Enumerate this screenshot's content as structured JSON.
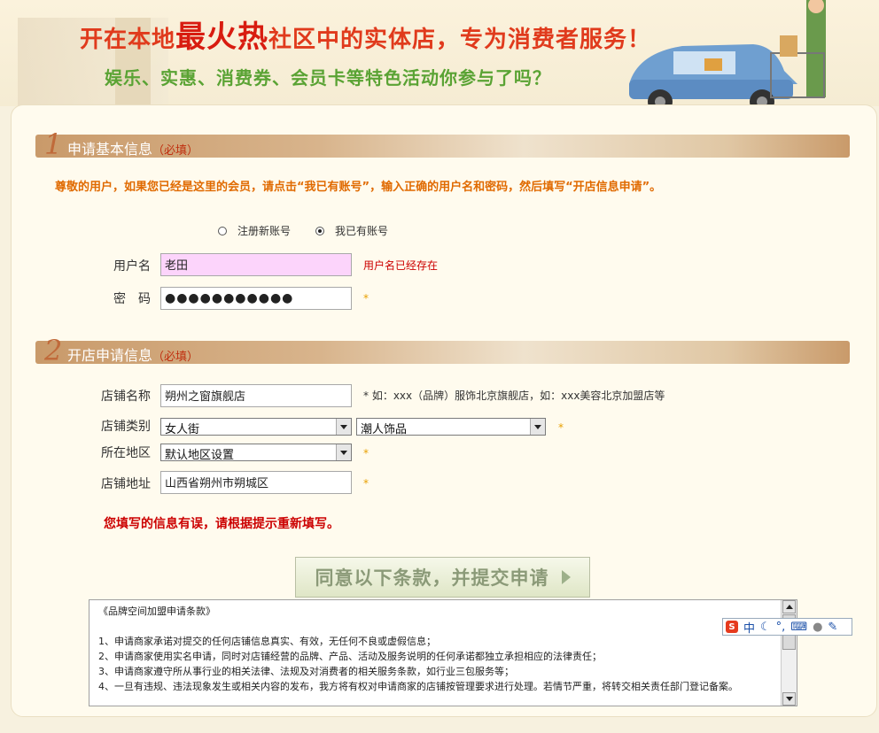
{
  "banner": {
    "headline_a": "开在本地",
    "headline_b": "最火热",
    "headline_c": "社区中的实体店，专为消费者服务！",
    "subline": "娱乐、实惠、消费券、会员卡等特色活动你参与了吗？"
  },
  "section1": {
    "num": "1",
    "title": "申请基本信息",
    "required": "（必填）"
  },
  "notice": "尊敬的用户，如果您已经是这里的会员，请点击“我已有账号”，输入正确的用户名和密码，然后填写“开店信息申请”。",
  "account": {
    "option_new": "注册新账号",
    "option_existing": "我已有账号",
    "selected": "option_existing"
  },
  "login": {
    "username_label": "用户名",
    "username_value": "老田",
    "username_error": "用户名已经存在",
    "password_label": "密　码",
    "password_mask": "●●●●●●●●●●●",
    "star": "*"
  },
  "section2": {
    "num": "2",
    "title": "开店申请信息",
    "required": "（必填）"
  },
  "shop": {
    "name_label": "店铺名称",
    "name_value": "朔州之窗旗舰店",
    "name_hint": "* 如：xxx（品牌）服饰北京旗舰店，如：xxx美容北京加盟店等",
    "type_label": "店铺类别",
    "type_value1": "女人街",
    "type_value2": "潮人饰品",
    "region_label": "所在地区",
    "region_value": "默认地区设置",
    "address_label": "店铺地址",
    "address_value": "山西省朔州市朔城区",
    "star": "*"
  },
  "form_error": "您填写的信息有误，请根据提示重新填写。",
  "submit_label": "同意以下条款，并提交申请",
  "terms": {
    "title": "《品牌空间加盟申请条款》",
    "items": [
      "1、申请商家承诺对提交的任何店铺信息真实、有效，无任何不良或虚假信息；",
      "2、申请商家使用实名申请，同时对店铺经营的品牌、产品、活动及服务说明的任何承诺都独立承担相应的法律责任；",
      "3、申请商家遵守所从事行业的相关法律、法规及对消费者的相关服务条款，如行业三包服务等；",
      "4、一旦有违规、违法现象发生或相关内容的发布，我方将有权对申请商家的店铺按管理要求进行处理。若情节严重，将转交相关责任部门登记备案。"
    ]
  },
  "ime": {
    "logo": "S",
    "mode": "中"
  },
  "colors": {
    "accent": "#e03a1c",
    "green": "#5aa334",
    "error": "#cc0000",
    "notice": "#e06a00"
  }
}
